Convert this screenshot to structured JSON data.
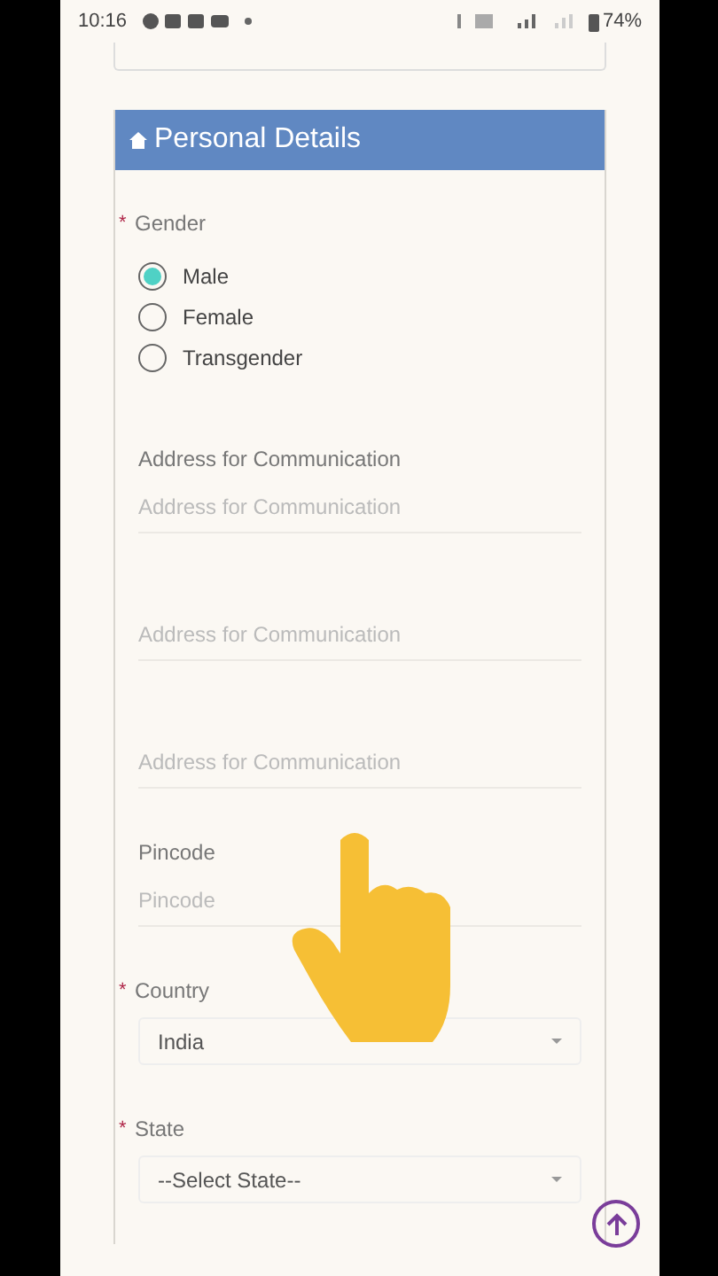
{
  "status_bar": {
    "time": "10:16",
    "battery": "74%"
  },
  "section": {
    "title": "Personal Details"
  },
  "fields": [
    {
      "kind": "radio",
      "label": "Gender",
      "marker": "*",
      "options": [
        {
          "label": "Male",
          "selected": true
        },
        {
          "label": "Female",
          "selected": false
        },
        {
          "label": "Transgender",
          "selected": false
        }
      ]
    },
    {
      "kind": "text",
      "label": "Address for Communication",
      "inputs": [
        {
          "placeholder": "Address for Communication"
        },
        {
          "placeholder": "Address for Communication"
        },
        {
          "placeholder": "Address for Communication"
        }
      ]
    },
    {
      "kind": "text",
      "label": "Pincode",
      "inputs": [
        {
          "placeholder": "Pincode"
        }
      ]
    },
    {
      "kind": "select",
      "label": "Country",
      "marker": "*",
      "value": "India"
    },
    {
      "kind": "select",
      "label": "State",
      "marker": "*",
      "value": "--Select State--"
    }
  ]
}
